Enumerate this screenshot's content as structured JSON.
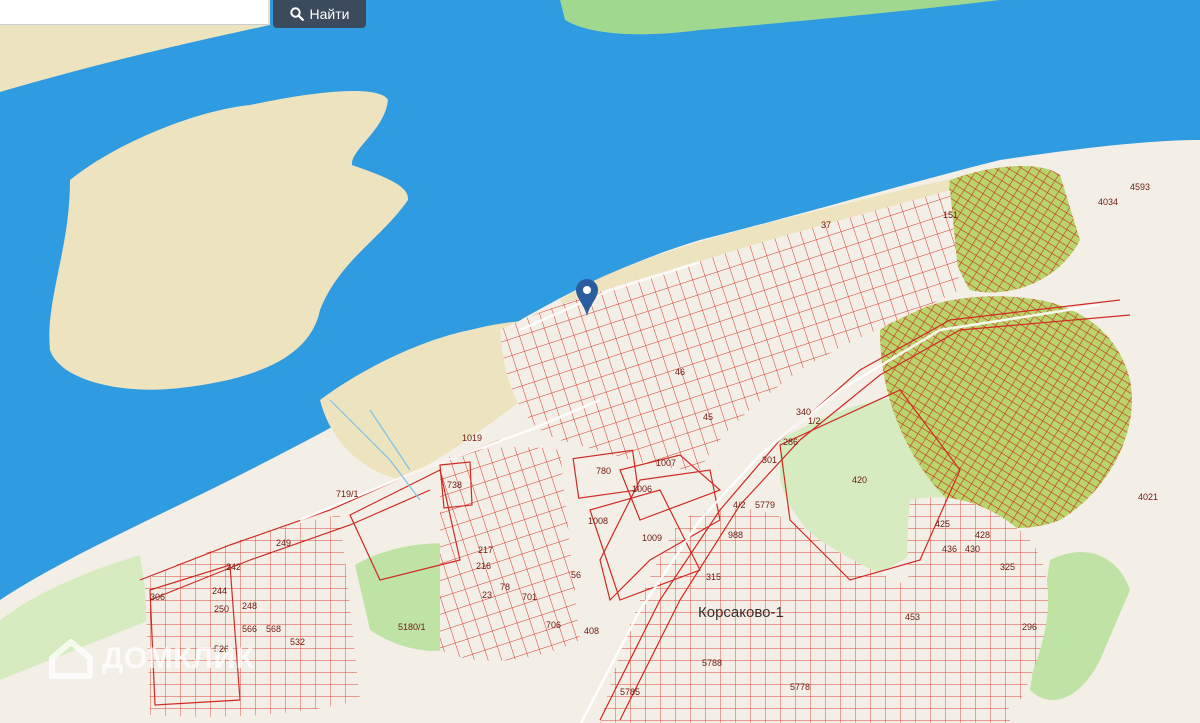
{
  "search": {
    "placeholder": "",
    "value": "",
    "button_label": "Найти"
  },
  "map": {
    "district_label": "Корсаково-1",
    "parcel_labels": [
      "1019",
      "719/1",
      "738",
      "780",
      "1006",
      "1007",
      "1008",
      "1009",
      "217",
      "216",
      "78",
      "23",
      "249",
      "242",
      "306",
      "244",
      "250",
      "248",
      "566",
      "568",
      "526",
      "532",
      "5180/1",
      "56",
      "701",
      "706",
      "408",
      "420",
      "4/2",
      "5779",
      "988",
      "315",
      "301",
      "286",
      "340",
      "1/2",
      "45",
      "46",
      "37",
      "151",
      "4034",
      "4593",
      "4021",
      "5785",
      "5788",
      "5778",
      "453",
      "425",
      "428",
      "436",
      "430",
      "325",
      "296"
    ],
    "colors": {
      "water": "#2f9be0",
      "sand": "#ede3bf",
      "land": "#f4efe6",
      "green": "#bfe3a4",
      "dense_green": "#b9d46a",
      "parcel_stroke": "#cf2a24"
    }
  },
  "marker": {
    "icon": "map-pin-icon",
    "color": "#2a5d9f"
  },
  "watermark": {
    "text": "ДОМКЛИК",
    "icon": "house-logo-icon"
  }
}
